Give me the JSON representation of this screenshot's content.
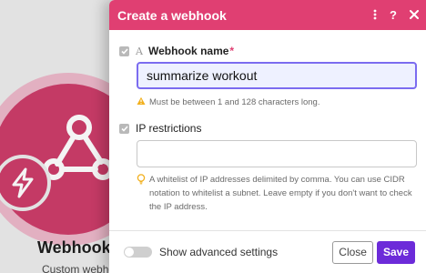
{
  "background": {
    "module_title": "Webhook",
    "module_subtitle": "Custom webho"
  },
  "dialog": {
    "title": "Create a webhook",
    "header_icons": [
      "more-vertical-icon",
      "help-icon",
      "close-icon"
    ]
  },
  "webhook_name": {
    "label": "Webhook name",
    "required_mark": "*",
    "value": "summarize workout",
    "hint": "Must be between 1 and 128 characters long."
  },
  "ip_restrictions": {
    "label": "IP restrictions",
    "value": "",
    "hint": "A whitelist of IP addresses delimited by comma. You can use CIDR notation to whitelist a subnet. Leave empty if you don't want to check the IP address."
  },
  "footer": {
    "advanced_label": "Show advanced settings",
    "advanced_enabled": false,
    "close_label": "Close",
    "save_label": "Save"
  },
  "colors": {
    "header": "#e03f72",
    "save_button": "#6c2bd9",
    "active_input_border": "#7b6cf0",
    "module_circle": "#cc3a68"
  }
}
